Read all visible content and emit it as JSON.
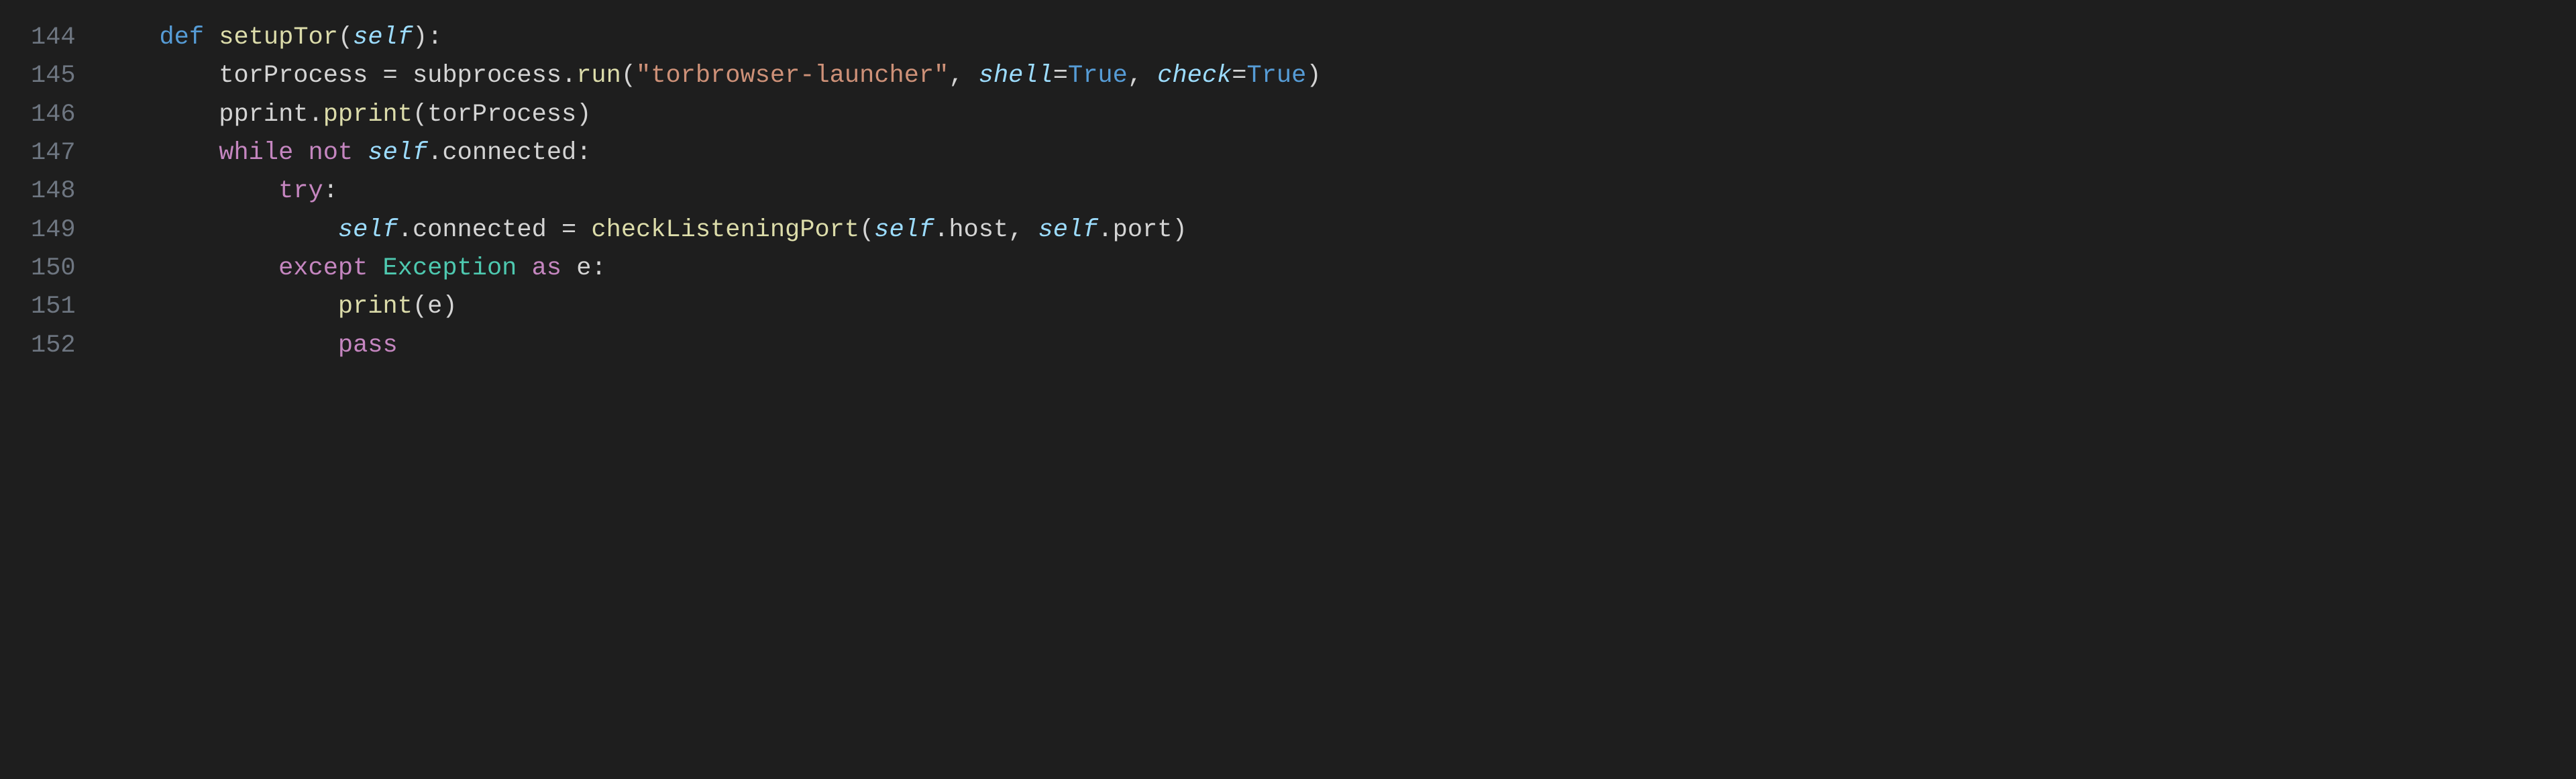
{
  "editor": {
    "line_numbers": [
      "144",
      "145",
      "146",
      "147",
      "148",
      "149",
      "150",
      "151",
      "152"
    ],
    "lines": [
      {
        "indent": "    ",
        "tokens": [
          {
            "cls": "kw-def",
            "text": "def"
          },
          {
            "cls": "default",
            "text": " "
          },
          {
            "cls": "fn-name",
            "text": "setupTor"
          },
          {
            "cls": "punct",
            "text": "("
          },
          {
            "cls": "selfkw",
            "text": "self"
          },
          {
            "cls": "punct",
            "text": "):"
          }
        ]
      },
      {
        "indent": "        ",
        "tokens": [
          {
            "cls": "default",
            "text": "torProcess "
          },
          {
            "cls": "punct",
            "text": "= "
          },
          {
            "cls": "default",
            "text": "subprocess."
          },
          {
            "cls": "call",
            "text": "run"
          },
          {
            "cls": "punct",
            "text": "("
          },
          {
            "cls": "string",
            "text": "\"torbrowser-launcher\""
          },
          {
            "cls": "punct",
            "text": ", "
          },
          {
            "cls": "param",
            "text": "shell"
          },
          {
            "cls": "punct",
            "text": "="
          },
          {
            "cls": "const",
            "text": "True"
          },
          {
            "cls": "punct",
            "text": ", "
          },
          {
            "cls": "param",
            "text": "check"
          },
          {
            "cls": "punct",
            "text": "="
          },
          {
            "cls": "const",
            "text": "True"
          },
          {
            "cls": "punct",
            "text": ")"
          }
        ]
      },
      {
        "indent": "        ",
        "tokens": [
          {
            "cls": "default",
            "text": "pprint."
          },
          {
            "cls": "call",
            "text": "pprint"
          },
          {
            "cls": "punct",
            "text": "("
          },
          {
            "cls": "default",
            "text": "torProcess"
          },
          {
            "cls": "punct",
            "text": ")"
          }
        ]
      },
      {
        "indent": "        ",
        "tokens": [
          {
            "cls": "kw-flow",
            "text": "while"
          },
          {
            "cls": "default",
            "text": " "
          },
          {
            "cls": "kw-flow",
            "text": "not"
          },
          {
            "cls": "default",
            "text": " "
          },
          {
            "cls": "selfkw",
            "text": "self"
          },
          {
            "cls": "punct",
            "text": "."
          },
          {
            "cls": "default",
            "text": "connected"
          },
          {
            "cls": "punct",
            "text": ":"
          }
        ]
      },
      {
        "indent": "            ",
        "tokens": [
          {
            "cls": "kw-flow",
            "text": "try"
          },
          {
            "cls": "punct",
            "text": ":"
          }
        ]
      },
      {
        "indent": "                ",
        "tokens": [
          {
            "cls": "selfkw",
            "text": "self"
          },
          {
            "cls": "punct",
            "text": "."
          },
          {
            "cls": "default",
            "text": "connected "
          },
          {
            "cls": "punct",
            "text": "= "
          },
          {
            "cls": "call",
            "text": "checkListeningPort"
          },
          {
            "cls": "punct",
            "text": "("
          },
          {
            "cls": "selfkw",
            "text": "self"
          },
          {
            "cls": "punct",
            "text": "."
          },
          {
            "cls": "default",
            "text": "host"
          },
          {
            "cls": "punct",
            "text": ", "
          },
          {
            "cls": "selfkw",
            "text": "self"
          },
          {
            "cls": "punct",
            "text": "."
          },
          {
            "cls": "default",
            "text": "port"
          },
          {
            "cls": "punct",
            "text": ")"
          }
        ]
      },
      {
        "indent": "            ",
        "tokens": [
          {
            "cls": "kw-flow",
            "text": "except"
          },
          {
            "cls": "default",
            "text": " "
          },
          {
            "cls": "clsname",
            "text": "Exception"
          },
          {
            "cls": "default",
            "text": " "
          },
          {
            "cls": "kw-flow",
            "text": "as"
          },
          {
            "cls": "default",
            "text": " "
          },
          {
            "cls": "var-e",
            "text": "e"
          },
          {
            "cls": "punct",
            "text": ":"
          }
        ]
      },
      {
        "indent": "                ",
        "tokens": [
          {
            "cls": "call",
            "text": "print"
          },
          {
            "cls": "punct",
            "text": "("
          },
          {
            "cls": "default",
            "text": "e"
          },
          {
            "cls": "punct",
            "text": ")"
          }
        ]
      },
      {
        "indent": "                ",
        "tokens": [
          {
            "cls": "kw-flow",
            "text": "pass"
          }
        ]
      }
    ]
  }
}
